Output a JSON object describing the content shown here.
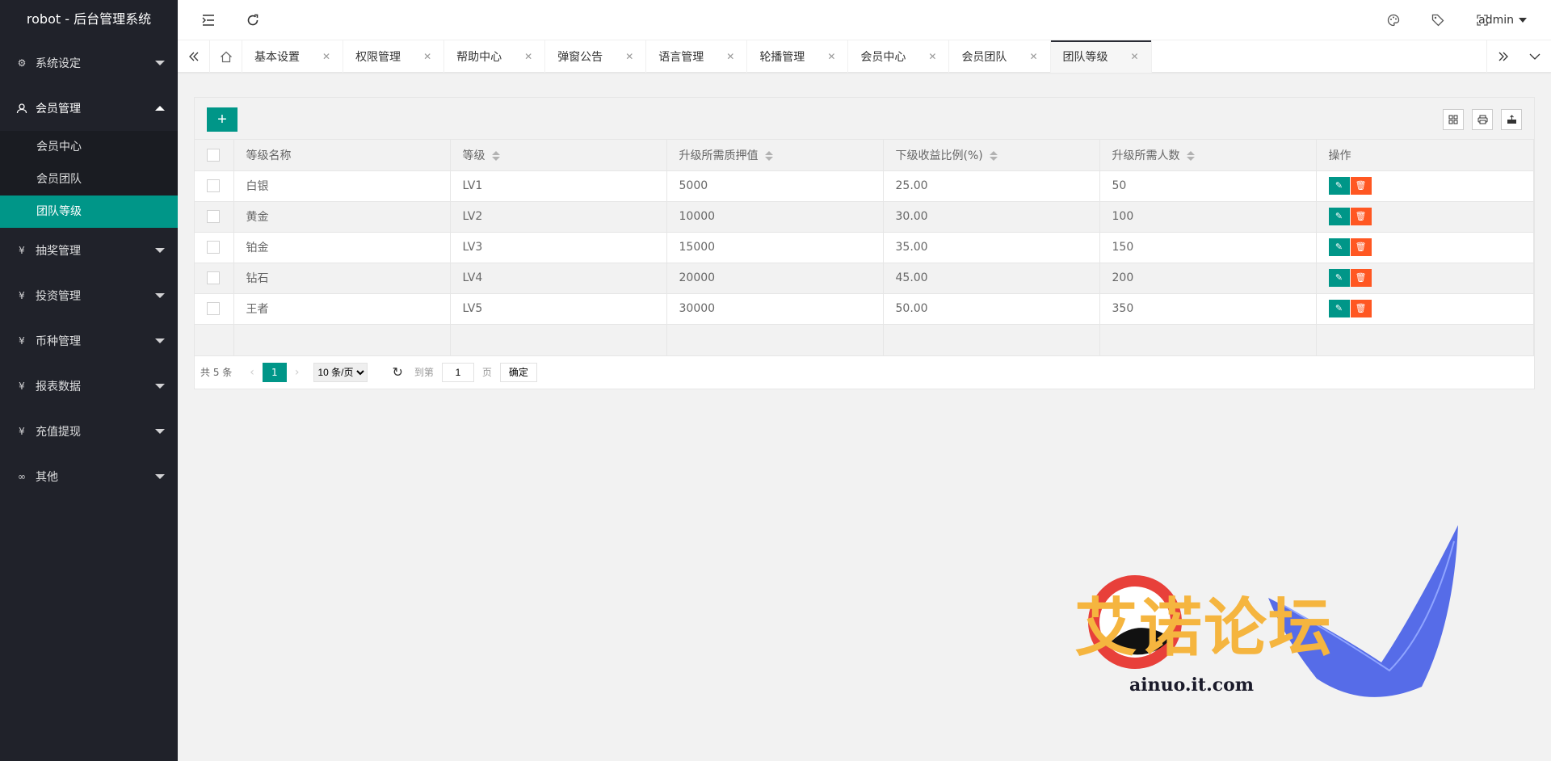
{
  "app": {
    "title": "robot - 后台管理系统"
  },
  "sidebar": {
    "groups": [
      {
        "label": "系统设定",
        "icon": "gear-icon",
        "expanded": false
      },
      {
        "label": "会员管理",
        "icon": "user-icon",
        "expanded": true,
        "items": [
          {
            "label": "会员中心"
          },
          {
            "label": "会员团队"
          },
          {
            "label": "团队等级",
            "active": true
          }
        ]
      },
      {
        "label": "抽奖管理",
        "icon": "yen-icon",
        "expanded": false
      },
      {
        "label": "投资管理",
        "icon": "yen-icon",
        "expanded": false
      },
      {
        "label": "币种管理",
        "icon": "yen-icon",
        "expanded": false
      },
      {
        "label": "报表数据",
        "icon": "yen-icon",
        "expanded": false
      },
      {
        "label": "充值提现",
        "icon": "yen-icon",
        "expanded": false
      },
      {
        "label": "其他",
        "icon": "link-icon",
        "expanded": false
      }
    ]
  },
  "header": {
    "user": "admin"
  },
  "tabs": [
    {
      "label": "基本设置"
    },
    {
      "label": "权限管理"
    },
    {
      "label": "帮助中心"
    },
    {
      "label": "弹窗公告"
    },
    {
      "label": "语言管理"
    },
    {
      "label": "轮播管理"
    },
    {
      "label": "会员中心"
    },
    {
      "label": "会员团队"
    },
    {
      "label": "团队等级",
      "active": true
    }
  ],
  "table": {
    "columns": [
      "等级名称",
      "等级",
      "升级所需质押值",
      "下级收益比例(%)",
      "升级所需人数",
      "操作"
    ],
    "rows": [
      {
        "name": "白银",
        "level": "LV1",
        "stake": "5000",
        "ratio": "25.00",
        "people": "50"
      },
      {
        "name": "黄金",
        "level": "LV2",
        "stake": "10000",
        "ratio": "30.00",
        "people": "100"
      },
      {
        "name": "铂金",
        "level": "LV3",
        "stake": "15000",
        "ratio": "35.00",
        "people": "150"
      },
      {
        "name": "钻石",
        "level": "LV4",
        "stake": "20000",
        "ratio": "45.00",
        "people": "200"
      },
      {
        "name": "王者",
        "level": "LV5",
        "stake": "30000",
        "ratio": "50.00",
        "people": "350"
      }
    ]
  },
  "pager": {
    "total": "共 5 条",
    "current": "1",
    "per_page": "10 条/页",
    "goto_label": "到第",
    "goto_value": "1",
    "page_suffix": "页",
    "confirm": "确定"
  },
  "watermark": {
    "text": "艾诺论坛",
    "url": "ainuo.it.com"
  },
  "colors": {
    "accent": "#009688",
    "danger": "#ff5722",
    "sidebar": "#20222a"
  }
}
